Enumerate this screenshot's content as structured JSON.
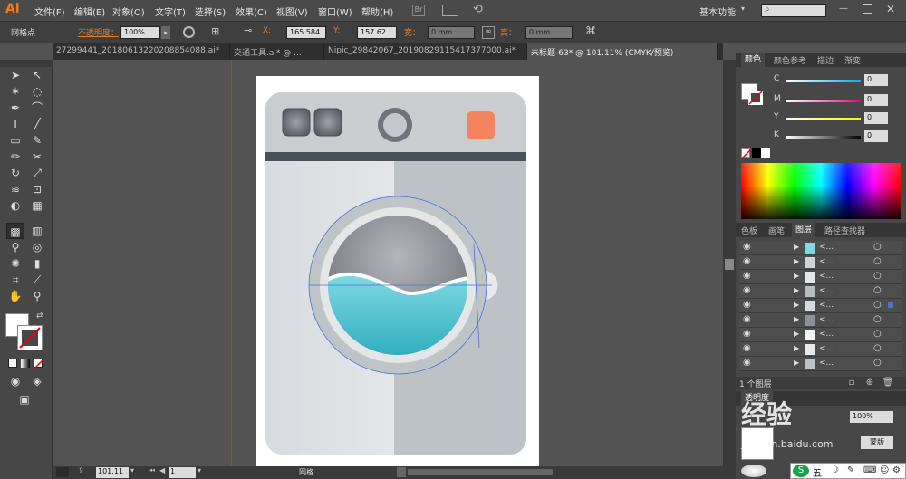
{
  "app": {
    "logo": "Ai"
  },
  "menu": [
    "文件(F)",
    "编辑(E)",
    "对象(O)",
    "文字(T)",
    "选择(S)",
    "效果(C)",
    "视图(V)",
    "窗口(W)",
    "帮助(H)"
  ],
  "workspace": "基本功能",
  "control": {
    "mode_label": "网格点",
    "opacity_label": "不透明度：",
    "opacity_value": "100%",
    "x_label": "X:",
    "x_value": "165.584",
    "y_label": "Y:",
    "y_value": "157.62",
    "w_label": "宽：",
    "w_value": "0 mm",
    "h_label": "高：",
    "h_value": "0 mm"
  },
  "tabs": [
    "27299441_20180613220208854088.ai*",
    "交通工具.ai* @ ...",
    "Nipic_29842067_20190829115417377000.ai*",
    "未标题-63* @ 101.11% (CMYK/预览)"
  ],
  "color_panel": {
    "tabs": [
      "颜色",
      "颜色参考",
      "描边",
      "渐变"
    ],
    "channels": [
      {
        "label": "C",
        "value": "0",
        "color": "#00aeef"
      },
      {
        "label": "M",
        "value": "0",
        "color": "#ec008c"
      },
      {
        "label": "Y",
        "value": "0",
        "color": "#fff200"
      },
      {
        "label": "K",
        "value": "0",
        "color": "#000000"
      }
    ]
  },
  "layers_panel": {
    "tabs": [
      "色板",
      "画笔",
      "图层",
      "路径查找器"
    ],
    "rows": [
      "<...",
      "<...",
      "<...",
      "<...",
      "<...",
      "<...",
      "<...",
      "<...",
      "<..."
    ],
    "footer": "1 个图层"
  },
  "transparency_panel": {
    "title": "透明度",
    "value": "100%",
    "mode_button": "蒙版"
  },
  "status": {
    "zoom": "101.11",
    "page": "1",
    "tool": "网格"
  },
  "watermark": {
    "text": "经验",
    "subtext": "jingyan.baidu.com"
  },
  "ime": {
    "text": "五"
  }
}
